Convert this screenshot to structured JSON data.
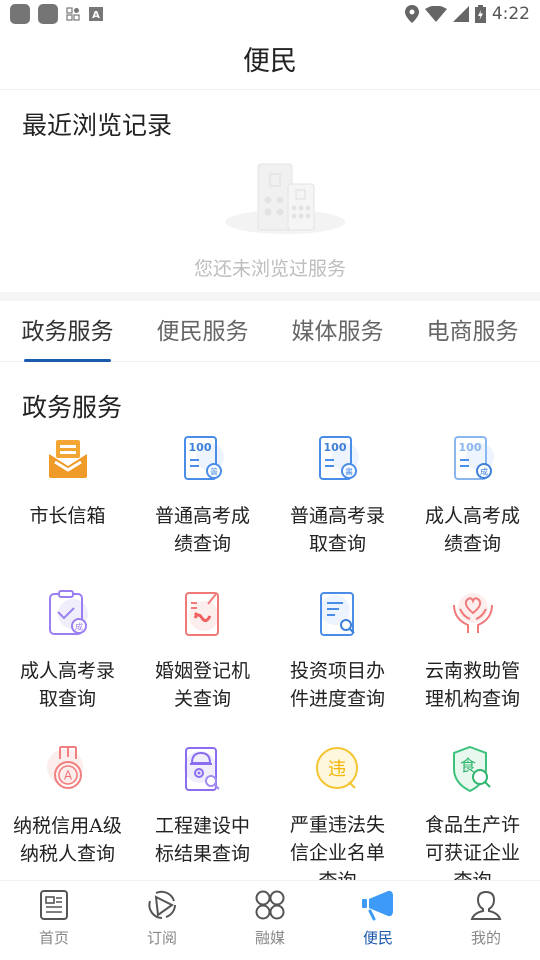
{
  "status_bar": {
    "time": "4:22"
  },
  "header": {
    "title": "便民"
  },
  "recent": {
    "title": "最近浏览记录",
    "empty_text": "您还未浏览过服务"
  },
  "tabs": [
    {
      "label": "政务服务",
      "active": true
    },
    {
      "label": "便民服务",
      "active": false
    },
    {
      "label": "媒体服务",
      "active": false
    },
    {
      "label": "电商服务",
      "active": false
    }
  ],
  "section": {
    "title": "政务服务",
    "items": [
      {
        "label": "市长信箱",
        "icon": "mailbox-icon"
      },
      {
        "label": "普通高考成绩查询",
        "icon": "exam-score-icon"
      },
      {
        "label": "普通高考录取查询",
        "icon": "exam-admission-icon"
      },
      {
        "label": "成人高考成绩查询",
        "icon": "adult-exam-score-icon"
      },
      {
        "label": "成人高考录取查询",
        "icon": "adult-exam-admission-icon"
      },
      {
        "label": "婚姻登记机关查询",
        "icon": "marriage-registration-icon"
      },
      {
        "label": "投资项目办件进度查询",
        "icon": "document-search-icon"
      },
      {
        "label": "云南救助管理机构查询",
        "icon": "helping-hands-heart-icon"
      },
      {
        "label": "纳税信用A级纳税人查询",
        "icon": "medal-a-icon"
      },
      {
        "label": "工程建设中标结果查询",
        "icon": "construction-helmet-search-icon"
      },
      {
        "label": "严重违法失信企业名单查询",
        "icon": "violation-badge-icon"
      },
      {
        "label": "食品生产许可获证企业查询",
        "icon": "food-shield-search-icon"
      }
    ]
  },
  "bottom_nav": [
    {
      "label": "首页",
      "icon": "news-icon",
      "active": false
    },
    {
      "label": "订阅",
      "icon": "subscribe-icon",
      "active": false
    },
    {
      "label": "融媒",
      "icon": "grid-four-icon",
      "active": false
    },
    {
      "label": "便民",
      "icon": "megaphone-icon",
      "active": true
    },
    {
      "label": "我的",
      "icon": "user-icon",
      "active": false
    }
  ],
  "colors": {
    "accent": "#1c5aad",
    "active_icon": "#3d9bf7"
  }
}
